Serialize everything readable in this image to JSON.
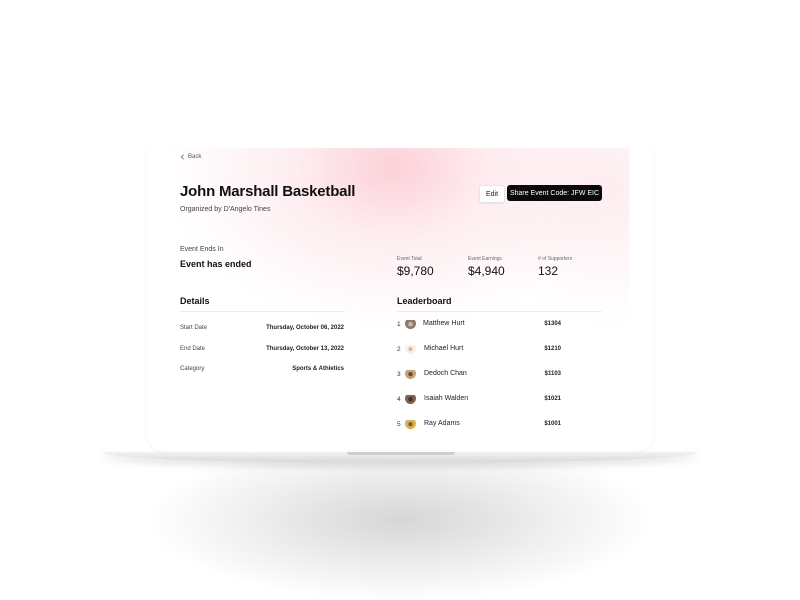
{
  "colors": {
    "accent_pink": "#fcc8d2",
    "button_dark": "#0a0a0a"
  },
  "nav": {
    "back_label": "Back",
    "back_icon": "chevron-left-icon"
  },
  "event": {
    "title": "John Marshall Basketball",
    "organizer": "Organized by D'Angelo Tines"
  },
  "actions": {
    "edit_label": "Edit",
    "share_label": "Share Event Code: JFW EIC"
  },
  "countdown": {
    "label": "Event Ends In",
    "value": "Event has ended"
  },
  "stats": [
    {
      "label": "Event Total",
      "value": "$9,780"
    },
    {
      "label": "Event Earnings",
      "value": "$4,940"
    },
    {
      "label": "# of Supporters",
      "value": "132"
    }
  ],
  "details": {
    "heading": "Details",
    "rows": [
      {
        "label": "Start Date",
        "value": "Thursday, October 06, 2022"
      },
      {
        "label": "End Date",
        "value": "Thursday, October 13, 2022"
      },
      {
        "label": "Category",
        "value": "Sports & Athletics"
      }
    ]
  },
  "leaderboard": {
    "heading": "Leaderboard",
    "rows": [
      {
        "rank": "1",
        "name": "Matthew Hurt",
        "amount": "$1304"
      },
      {
        "rank": "2",
        "name": "Michael Hurt",
        "amount": "$1210"
      },
      {
        "rank": "3",
        "name": "Dedoch Chan",
        "amount": "$1103"
      },
      {
        "rank": "4",
        "name": "Isaiah Walden",
        "amount": "$1021"
      },
      {
        "rank": "5",
        "name": "Ray Adams",
        "amount": "$1001"
      }
    ]
  }
}
